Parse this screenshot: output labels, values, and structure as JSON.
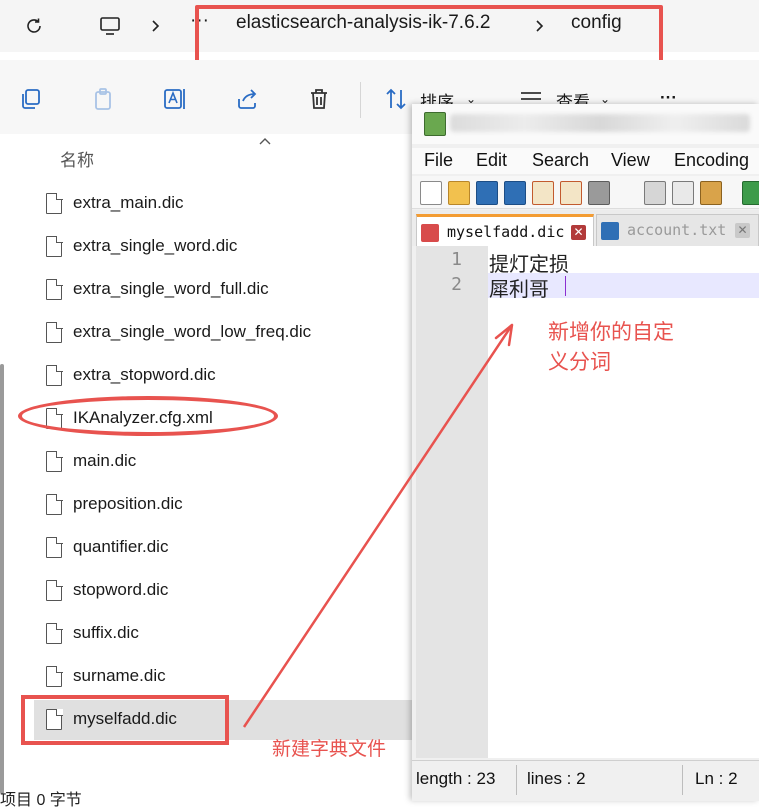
{
  "explorer": {
    "breadcrumb": {
      "more": "···",
      "folder": "elasticsearch-analysis-ik-7.6.2",
      "separator": ">",
      "current": "config"
    },
    "toolbar": {
      "sort_label": "排序",
      "view_label": "查看",
      "more": "···"
    },
    "column_header": "名称",
    "files": [
      "extra_main.dic",
      "extra_single_word.dic",
      "extra_single_word_full.dic",
      "extra_single_word_low_freq.dic",
      "extra_stopword.dic",
      "IKAnalyzer.cfg.xml",
      "main.dic",
      "preposition.dic",
      "quantifier.dic",
      "stopword.dic",
      "suffix.dic",
      "surname.dic",
      "myselfadd.dic"
    ],
    "status": "项目 0 字节"
  },
  "notepad": {
    "menu": [
      "File",
      "Edit",
      "Search",
      "View",
      "Encoding"
    ],
    "tabs": [
      {
        "label": "myselfadd.dic",
        "active": true
      },
      {
        "label": "account.txt",
        "active": false
      }
    ],
    "lines": [
      {
        "no": "1",
        "text": "提灯定损"
      },
      {
        "no": "2",
        "text": "犀利哥"
      }
    ],
    "status": {
      "length": "length : 23",
      "lines": "lines : 2",
      "ln": "Ln : 2"
    }
  },
  "annotations": {
    "note_custom_words_line1": "新增你的自定",
    "note_custom_words_line2": "义分词",
    "note_new_dict": "新建字典文件",
    "color": "#e8534f"
  }
}
